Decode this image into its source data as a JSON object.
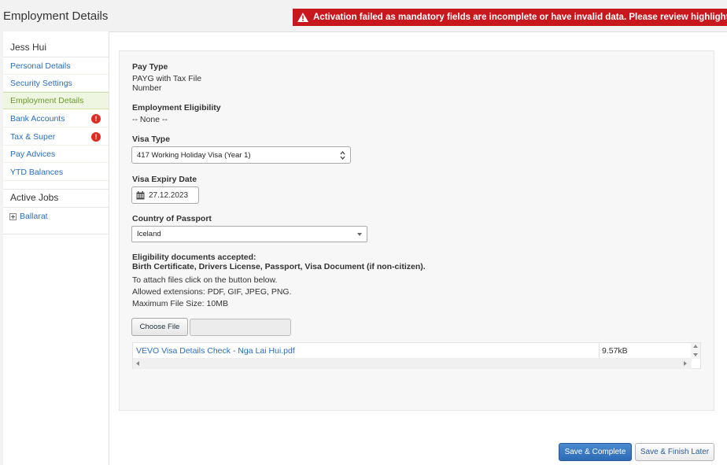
{
  "page": {
    "title": "Employment Details"
  },
  "error_banner": {
    "message": "Activation failed as mandatory fields are incomplete or have invalid data. Please review highlighted fields."
  },
  "sidebar": {
    "user_name": "Jess Hui",
    "items": [
      {
        "label": "Personal Details"
      },
      {
        "label": "Security Settings"
      },
      {
        "label": "Employment Details"
      },
      {
        "label": "Bank Accounts",
        "badge": "!"
      },
      {
        "label": "Tax & Super",
        "badge": "!"
      },
      {
        "label": "Pay Advices"
      },
      {
        "label": "YTD Balances"
      }
    ],
    "active_item": "Employment Details",
    "jobs_heading": "Active Jobs",
    "jobs": [
      {
        "label": "Ballarat"
      }
    ]
  },
  "form": {
    "pay_type": {
      "label": "Pay Type",
      "value_line1": "PAYG with Tax File",
      "value_line2": "Number"
    },
    "eligibility": {
      "label": "Employment Eligibility",
      "value": "-- None --"
    },
    "visa_type": {
      "label": "Visa Type",
      "value": "417 Working Holiday Visa (Year 1)"
    },
    "visa_expiry": {
      "label": "Visa Expiry Date",
      "value": "27.12.2023"
    },
    "passport_country": {
      "label": "Country of Passport",
      "value": "Iceland"
    },
    "documents": {
      "heading": "Eligibility documents accepted:",
      "accepted": "Birth Certificate, Drivers License, Passport, Visa Document (if non-citizen).",
      "instruction": "To attach files click on the button below.",
      "extensions": "Allowed extensions: PDF, GIF, JPEG, PNG.",
      "max_size": "Maximum File Size: 10MB",
      "choose_button": "Choose File",
      "files": [
        {
          "name": "VEVO Visa Details Check - Nga Lai Hui.pdf",
          "size": "9.57kB"
        }
      ]
    }
  },
  "footer": {
    "save_complete": "Save & Complete",
    "save_later": "Save & Finish Later"
  },
  "colors": {
    "error": "#c8181e",
    "link": "#2a6ebb",
    "active_nav": "#6a9a2a",
    "badge": "#e02b20",
    "primary_button": "#2d6cb5"
  },
  "icons": {
    "warning": "warning-icon",
    "calendar": "calendar-icon",
    "expand": "plus-box-icon"
  }
}
